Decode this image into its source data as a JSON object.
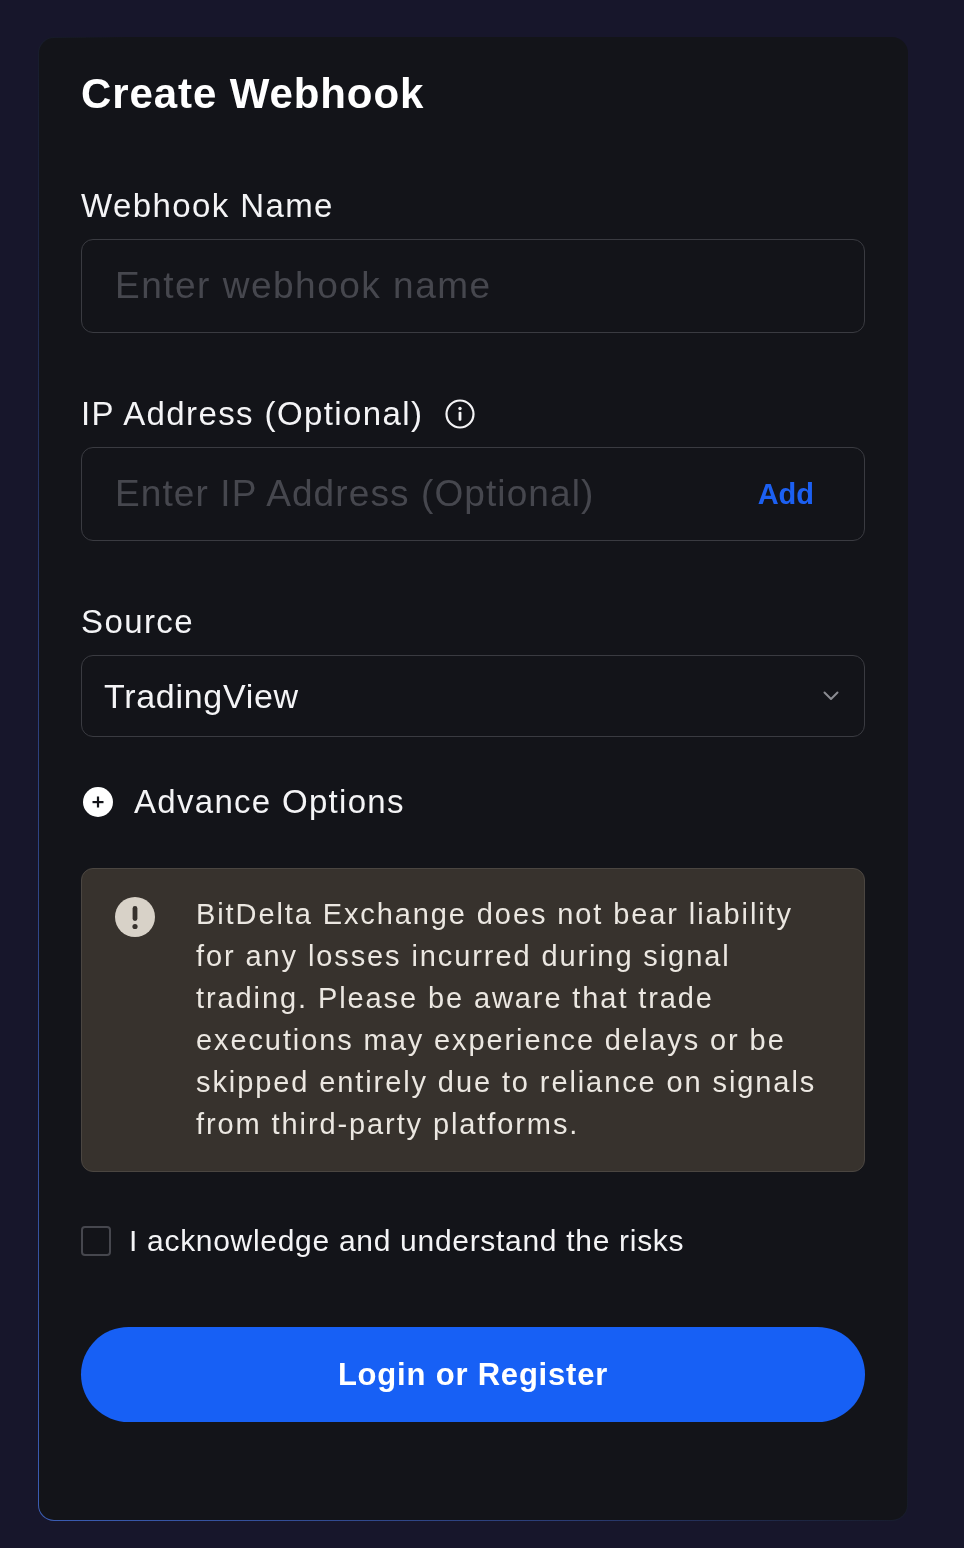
{
  "title": "Create Webhook",
  "fields": [
    {
      "kind": "text",
      "label": "Webhook Name",
      "info": false,
      "placeholder": "Enter webhook name"
    },
    {
      "kind": "text-action",
      "label": "IP Address (Optional)",
      "info": true,
      "placeholder": "Enter IP Address (Optional)",
      "action": "Add"
    },
    {
      "kind": "select",
      "label": "Source",
      "info": false,
      "value": "TradingView"
    }
  ],
  "advance_options": {
    "label": "Advance Options",
    "expanded": false
  },
  "notice": {
    "text": "BitDelta Exchange does not bear liability for any losses incurred during signal trading. Please be aware that trade executions may experience delays or be skipped entirely due to reliance on signals from third-party platforms."
  },
  "acknowledge": {
    "label": "I acknowledge and understand the risks",
    "checked": false
  },
  "submit": {
    "label": "Login or Register"
  }
}
